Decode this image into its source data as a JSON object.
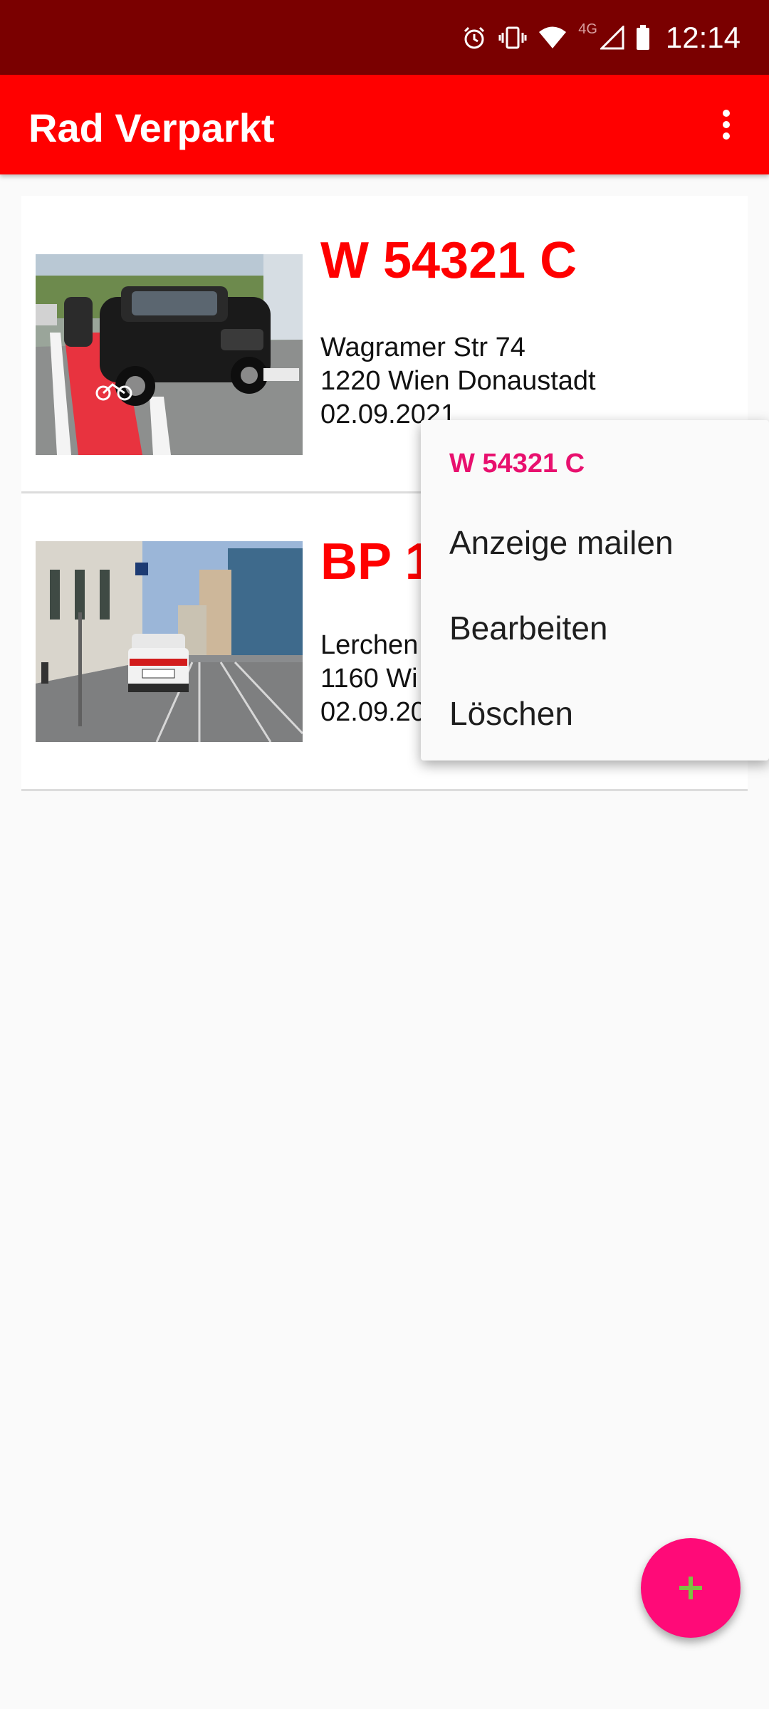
{
  "status_bar": {
    "time": "12:14",
    "network_label": "4G",
    "icons": [
      "alarm-icon",
      "vibrate-icon",
      "wifi-icon",
      "signal-icon",
      "battery-icon"
    ]
  },
  "app_bar": {
    "title": "Rad Verparkt",
    "overflow_icon": "more-vert-icon"
  },
  "reports": [
    {
      "plate": "W 54321 C",
      "street": "Wagramer Str 74",
      "city": "1220 Wien Donaustadt",
      "date": "02.09.2021"
    },
    {
      "plate": "BP 1",
      "street": "Lerchen",
      "city": "1160 Wi",
      "date": "02.09.20"
    }
  ],
  "context_menu": {
    "header": "W 54321 C",
    "items": [
      "Anzeige mailen",
      "Bearbeiten",
      "Löschen"
    ]
  },
  "fab": {
    "icon": "add-icon"
  },
  "colors": {
    "status_bar": "#7a0000",
    "app_bar": "#ff0000",
    "plate_text": "#ff0000",
    "menu_header": "#e8106e",
    "fab": "#ff0a78",
    "fab_icon": "#7cc242"
  }
}
